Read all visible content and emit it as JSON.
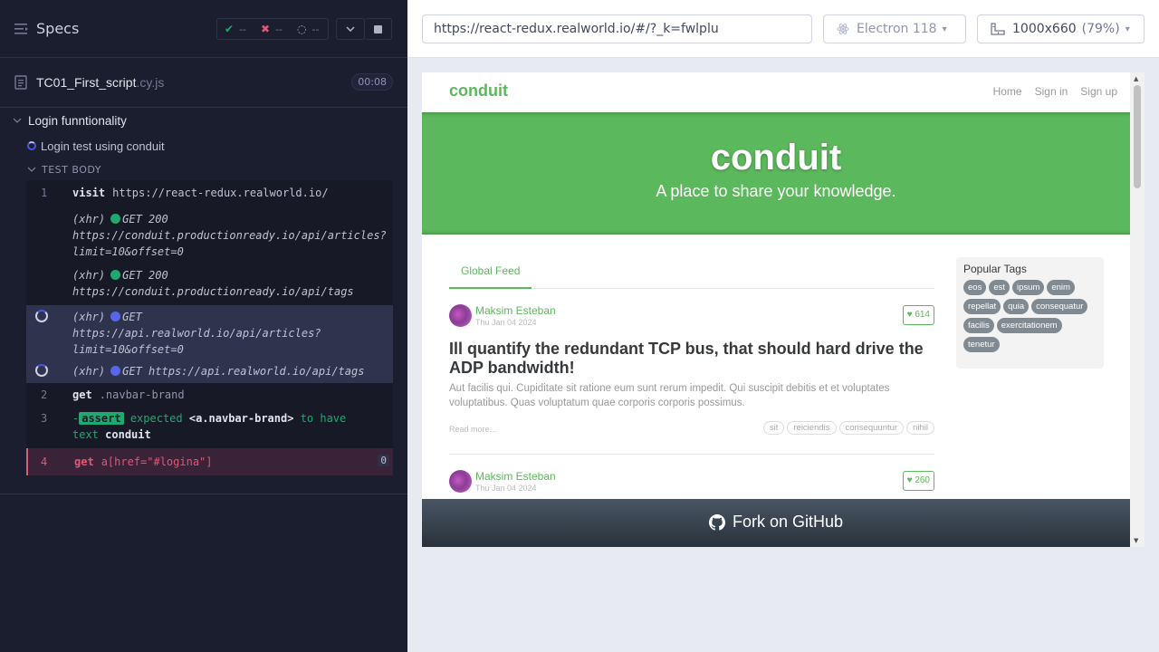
{
  "reporter": {
    "title": "Specs",
    "stats": {
      "passed": "--",
      "failed": "--",
      "pending": "--"
    },
    "spec": {
      "name": "TC01_First_script",
      "ext": ".cy.js",
      "duration": "00:08"
    },
    "suite": {
      "title": "Login funntionality"
    },
    "test": {
      "title": "Login test using conduit"
    },
    "body_label": "TEST BODY",
    "commands": {
      "c1": {
        "num": "1",
        "name": "visit",
        "msg": "https://react-redux.realworld.io/"
      },
      "x1": {
        "label": "(xhr)",
        "method": "GET 200",
        "line1": "https://conduit.productionready.io/api/articles?",
        "line2": "limit=10&offset=0"
      },
      "x2": {
        "label": "(xhr)",
        "method": "GET 200",
        "line1": "https://conduit.productionready.io/api/tags"
      },
      "x3": {
        "label": "(xhr)",
        "method": "GET",
        "line1": "https://api.realworld.io/api/articles?",
        "line2": "limit=10&offset=0"
      },
      "x4": {
        "label": "(xhr)",
        "method": "GET",
        "line1": "https://api.realworld.io/api/tags"
      },
      "c2": {
        "num": "2",
        "name": "get",
        "msg": ".navbar-brand"
      },
      "c3": {
        "num": "3",
        "prefix": "-",
        "tag": "assert",
        "expected": "expected",
        "selector": "<a.navbar-brand>",
        "tohave": "to have",
        "text": "text",
        "value": "conduit"
      },
      "c4": {
        "num": "4",
        "name": "get",
        "msg": "a[href=\"#logina\"]",
        "count": "0"
      }
    }
  },
  "aut": {
    "url": "https://react-redux.realworld.io/#/?_k=fwlplu",
    "browser": "Electron 118",
    "viewport": "1000x660",
    "zoom": "(79%)",
    "site": {
      "brand": "conduit",
      "nav": [
        "Home",
        "Sign in",
        "Sign up"
      ],
      "banner_title": "conduit",
      "banner_sub": "A place to share your knowledge.",
      "feed_tab": "Global Feed",
      "articles": [
        {
          "author": "Maksim Esteban",
          "date": "Thu Jan 04 2024",
          "likes": "614",
          "title": "Ill quantify the redundant TCP bus, that should hard drive the ADP bandwidth!",
          "desc": "Aut facilis qui. Cupiditate sit ratione eum sunt rerum impedit. Qui suscipit debitis et et voluptates voluptatibus. Quas voluptatum quae corporis corporis possimus.",
          "read_more": "Read more...",
          "tags": [
            "sit",
            "reiciendis",
            "consequuntur",
            "nihil"
          ]
        },
        {
          "author": "Maksim Esteban",
          "date": "Thu Jan 04 2024",
          "likes": "260"
        }
      ],
      "popular_title": "Popular Tags",
      "popular_tags": [
        "eos",
        "est",
        "ipsum",
        "enim",
        "repellat",
        "quia",
        "consequatur",
        "facilis",
        "exercitationem",
        "tenetur"
      ],
      "fork": "Fork on GitHub"
    }
  },
  "colors": {
    "accent": "#5cb85c",
    "fail": "#e45770",
    "pass": "#1fa971",
    "pending": "#5866e8",
    "reporter_bg": "#1b1e2e"
  }
}
